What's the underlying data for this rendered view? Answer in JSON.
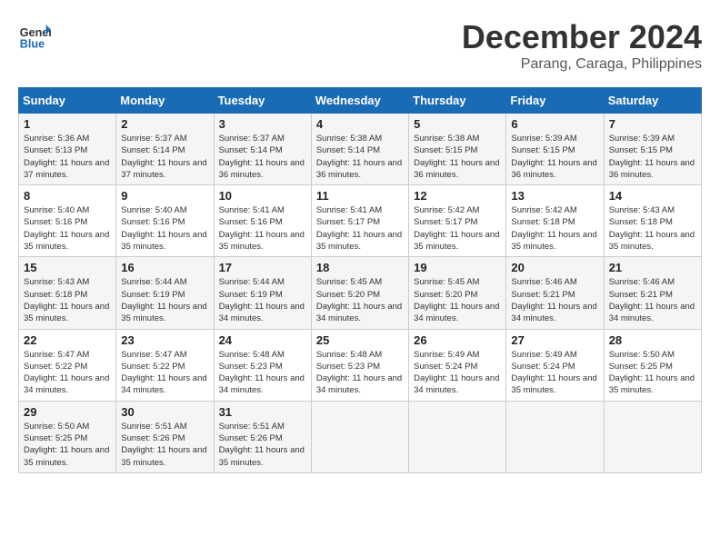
{
  "header": {
    "logo_line1": "General",
    "logo_line2": "Blue",
    "month": "December 2024",
    "location": "Parang, Caraga, Philippines"
  },
  "weekdays": [
    "Sunday",
    "Monday",
    "Tuesday",
    "Wednesday",
    "Thursday",
    "Friday",
    "Saturday"
  ],
  "weeks": [
    [
      {
        "day": "1",
        "sunrise": "5:36 AM",
        "sunset": "5:13 PM",
        "daylight": "11 hours and 37 minutes."
      },
      {
        "day": "2",
        "sunrise": "5:37 AM",
        "sunset": "5:14 PM",
        "daylight": "11 hours and 37 minutes."
      },
      {
        "day": "3",
        "sunrise": "5:37 AM",
        "sunset": "5:14 PM",
        "daylight": "11 hours and 36 minutes."
      },
      {
        "day": "4",
        "sunrise": "5:38 AM",
        "sunset": "5:14 PM",
        "daylight": "11 hours and 36 minutes."
      },
      {
        "day": "5",
        "sunrise": "5:38 AM",
        "sunset": "5:15 PM",
        "daylight": "11 hours and 36 minutes."
      },
      {
        "day": "6",
        "sunrise": "5:39 AM",
        "sunset": "5:15 PM",
        "daylight": "11 hours and 36 minutes."
      },
      {
        "day": "7",
        "sunrise": "5:39 AM",
        "sunset": "5:15 PM",
        "daylight": "11 hours and 36 minutes."
      }
    ],
    [
      {
        "day": "8",
        "sunrise": "5:40 AM",
        "sunset": "5:16 PM",
        "daylight": "11 hours and 35 minutes."
      },
      {
        "day": "9",
        "sunrise": "5:40 AM",
        "sunset": "5:16 PM",
        "daylight": "11 hours and 35 minutes."
      },
      {
        "day": "10",
        "sunrise": "5:41 AM",
        "sunset": "5:16 PM",
        "daylight": "11 hours and 35 minutes."
      },
      {
        "day": "11",
        "sunrise": "5:41 AM",
        "sunset": "5:17 PM",
        "daylight": "11 hours and 35 minutes."
      },
      {
        "day": "12",
        "sunrise": "5:42 AM",
        "sunset": "5:17 PM",
        "daylight": "11 hours and 35 minutes."
      },
      {
        "day": "13",
        "sunrise": "5:42 AM",
        "sunset": "5:18 PM",
        "daylight": "11 hours and 35 minutes."
      },
      {
        "day": "14",
        "sunrise": "5:43 AM",
        "sunset": "5:18 PM",
        "daylight": "11 hours and 35 minutes."
      }
    ],
    [
      {
        "day": "15",
        "sunrise": "5:43 AM",
        "sunset": "5:18 PM",
        "daylight": "11 hours and 35 minutes."
      },
      {
        "day": "16",
        "sunrise": "5:44 AM",
        "sunset": "5:19 PM",
        "daylight": "11 hours and 35 minutes."
      },
      {
        "day": "17",
        "sunrise": "5:44 AM",
        "sunset": "5:19 PM",
        "daylight": "11 hours and 34 minutes."
      },
      {
        "day": "18",
        "sunrise": "5:45 AM",
        "sunset": "5:20 PM",
        "daylight": "11 hours and 34 minutes."
      },
      {
        "day": "19",
        "sunrise": "5:45 AM",
        "sunset": "5:20 PM",
        "daylight": "11 hours and 34 minutes."
      },
      {
        "day": "20",
        "sunrise": "5:46 AM",
        "sunset": "5:21 PM",
        "daylight": "11 hours and 34 minutes."
      },
      {
        "day": "21",
        "sunrise": "5:46 AM",
        "sunset": "5:21 PM",
        "daylight": "11 hours and 34 minutes."
      }
    ],
    [
      {
        "day": "22",
        "sunrise": "5:47 AM",
        "sunset": "5:22 PM",
        "daylight": "11 hours and 34 minutes."
      },
      {
        "day": "23",
        "sunrise": "5:47 AM",
        "sunset": "5:22 PM",
        "daylight": "11 hours and 34 minutes."
      },
      {
        "day": "24",
        "sunrise": "5:48 AM",
        "sunset": "5:23 PM",
        "daylight": "11 hours and 34 minutes."
      },
      {
        "day": "25",
        "sunrise": "5:48 AM",
        "sunset": "5:23 PM",
        "daylight": "11 hours and 34 minutes."
      },
      {
        "day": "26",
        "sunrise": "5:49 AM",
        "sunset": "5:24 PM",
        "daylight": "11 hours and 34 minutes."
      },
      {
        "day": "27",
        "sunrise": "5:49 AM",
        "sunset": "5:24 PM",
        "daylight": "11 hours and 35 minutes."
      },
      {
        "day": "28",
        "sunrise": "5:50 AM",
        "sunset": "5:25 PM",
        "daylight": "11 hours and 35 minutes."
      }
    ],
    [
      {
        "day": "29",
        "sunrise": "5:50 AM",
        "sunset": "5:25 PM",
        "daylight": "11 hours and 35 minutes."
      },
      {
        "day": "30",
        "sunrise": "5:51 AM",
        "sunset": "5:26 PM",
        "daylight": "11 hours and 35 minutes."
      },
      {
        "day": "31",
        "sunrise": "5:51 AM",
        "sunset": "5:26 PM",
        "daylight": "11 hours and 35 minutes."
      },
      null,
      null,
      null,
      null
    ]
  ]
}
